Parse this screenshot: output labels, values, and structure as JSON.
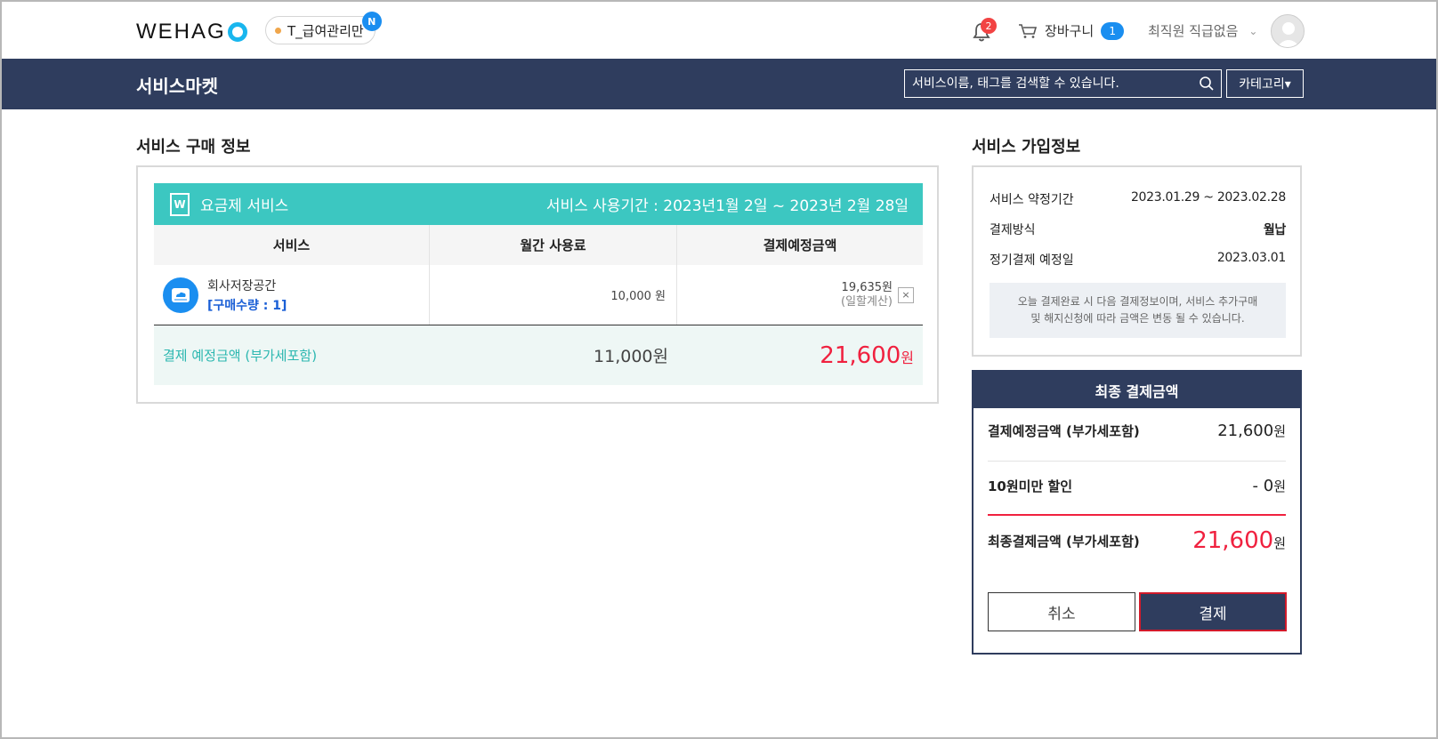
{
  "header": {
    "logo_text": "WEHAG",
    "company_name": "T_급여관리만",
    "company_new_badge": "N",
    "notifications_count": "2",
    "cart_label": "장바구니",
    "cart_count": "1",
    "user_name": "최직원 직급없음"
  },
  "nav": {
    "title": "서비스마켓",
    "search_placeholder": "서비스이름, 태그를 검색할 수 있습니다.",
    "category_label": "카테고리▾"
  },
  "purchase": {
    "section_title": "서비스 구매 정보",
    "plan_label": "요금제 서비스",
    "plan_icon_glyph": "W",
    "period": "서비스 사용기간 : 2023년1월 2일 ~ 2023년 2월 28일",
    "columns": [
      "서비스",
      "월간 사용료",
      "결제예정금액"
    ],
    "rows": [
      {
        "service": "회사저장공간",
        "quantity": "[구매수량 : 1]",
        "monthly_fee": "10,000 원",
        "amount": "19,635원",
        "amount_note": "(일할계산)",
        "remove_label": "×"
      }
    ],
    "total_label": "결제 예정금액 (부가세포함)",
    "total_monthly": "11,000원",
    "total_amount_value": "21,600",
    "total_amount_unit": "원"
  },
  "subscription": {
    "section_title": "서비스 가입정보",
    "contract_label": "서비스 약정기간",
    "contract_value": "2023.01.29 ~ 2023.02.28",
    "method_label": "결제방식",
    "method_value": "월납",
    "next_label": "정기결제 예정일",
    "next_value": "2023.03.01",
    "notice_line1": "오늘 결제완료 시 다음 결제정보이며, 서비스 추가구매",
    "notice_line2": "및 해지신청에 따라 금액은 변동 될 수 있습니다."
  },
  "final": {
    "title": "최종 결제금액",
    "expected_label": "결제예정금액 (부가세포함)",
    "expected_value": "21,600",
    "expected_unit": "원",
    "discount_label": "10원미만 할인",
    "discount_value": "- 0",
    "discount_unit": "원",
    "final_label": "최종결제금액 (부가세포함)",
    "final_value": "21,600",
    "final_unit": "원",
    "cancel_label": "취소",
    "pay_label": "결제"
  },
  "colors": {
    "navy": "#2f3d5e",
    "teal": "#3cc7c1",
    "red": "#f0213f",
    "blue": "#1a8ef0"
  }
}
